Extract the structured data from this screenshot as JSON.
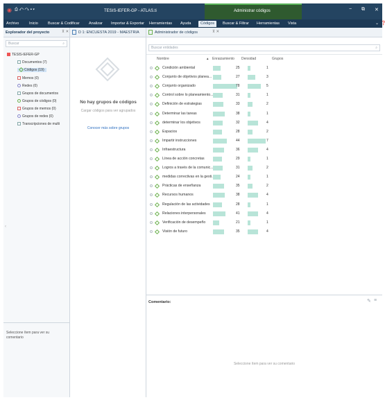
{
  "window": {
    "title": "TESIS-IEFER-GP - ATLAS.ti",
    "context_tab": "Administrar códigos",
    "controls": [
      "−",
      "⧉",
      "✕"
    ]
  },
  "ribbon": {
    "tabs": [
      {
        "label": "Archivo",
        "active": false
      },
      {
        "label": "Inicio",
        "active": false
      },
      {
        "label": "Buscar & Codificar",
        "active": false
      },
      {
        "label": "Analizar",
        "active": false
      },
      {
        "label": "Importar & Exportar",
        "active": false
      },
      {
        "label": "Herramientas",
        "active": false
      },
      {
        "label": "Ayuda",
        "active": false
      },
      {
        "label": "Códigos",
        "active": true
      },
      {
        "label": "Buscar & Filtrar",
        "active": false
      },
      {
        "label": "Herramientas",
        "active": false
      },
      {
        "label": "Vista",
        "active": false
      }
    ]
  },
  "explorer": {
    "title": "Explorador del proyecto",
    "search_placeholder": "Buscar",
    "items": [
      {
        "label": "TESIS-IEFER-GP",
        "icon": "project-icon",
        "indent": 0
      },
      {
        "label": "Documentos (7)",
        "icon": "document-icon",
        "indent": 1
      },
      {
        "label": "Códigos (19)",
        "icon": "code-icon",
        "indent": 1,
        "selected": true
      },
      {
        "label": "Memos (0)",
        "icon": "memo-icon",
        "indent": 1
      },
      {
        "label": "Redes (0)",
        "icon": "network-icon",
        "indent": 1
      },
      {
        "label": "Grupos de documentos",
        "icon": "doc-group-icon",
        "indent": 1
      },
      {
        "label": "Grupos de códigos (0)",
        "icon": "code-group-icon",
        "indent": 1
      },
      {
        "label": "Grupos de memos (0)",
        "icon": "memo-group-icon",
        "indent": 1
      },
      {
        "label": "Grupos de redes (0)",
        "icon": "network-group-icon",
        "indent": 1
      },
      {
        "label": "Transcripciones de multi",
        "icon": "transcript-icon",
        "indent": 1
      }
    ],
    "comment_hint": "Seleccione ítem para ver su comentario"
  },
  "groups_panel": {
    "tab": "D 1: ENCUESTA 2019 - MAESTRIA",
    "empty_title": "No hay grupos de códigos",
    "empty_subtitle": "Cargar códigos para ver agrupados",
    "learn_more": "Conocer más sobre grupos"
  },
  "codes_manager": {
    "tab": "Administrador de códigos",
    "search_placeholder": "Buscar entidades",
    "columns": {
      "name": "Nombre",
      "grounded": "Enraizamiento",
      "density": "Densidad",
      "groups": "Grupos"
    },
    "sort_indicator": "▲",
    "rows": [
      {
        "name": "Condición ambiental",
        "grounded": 25,
        "density": 1
      },
      {
        "name": "Conjunto de objetivos planea...",
        "grounded": 27,
        "density": 3
      },
      {
        "name": "Conjunto organizado",
        "grounded": 78,
        "density": 5
      },
      {
        "name": "Control sobre lo planeamiento...",
        "grounded": 31,
        "density": 1
      },
      {
        "name": "Definición de estrategias",
        "grounded": 33,
        "density": 2
      },
      {
        "name": "Determinar las tareas",
        "grounded": 38,
        "density": 1
      },
      {
        "name": "determinar los objetivos",
        "grounded": 32,
        "density": 4
      },
      {
        "name": "Espacios",
        "grounded": 28,
        "density": 2
      },
      {
        "name": "Impartir instrucciones",
        "grounded": 44,
        "density": 7
      },
      {
        "name": "Infraestructura",
        "grounded": 36,
        "density": 4
      },
      {
        "name": "Línea de acción concretas",
        "grounded": 29,
        "density": 1
      },
      {
        "name": "Logros a través de la comunic...",
        "grounded": 31,
        "density": 2
      },
      {
        "name": "medidas correctivas en la gesti...",
        "grounded": 24,
        "density": 1
      },
      {
        "name": "Prácticas de enseñanza",
        "grounded": 35,
        "density": 2
      },
      {
        "name": "Recursos humanos",
        "grounded": 38,
        "density": 4
      },
      {
        "name": "Regulación de las actividades",
        "grounded": 28,
        "density": 1
      },
      {
        "name": "Relaciones interpersonales",
        "grounded": 41,
        "density": 4
      },
      {
        "name": "Verificación de desempeño",
        "grounded": 21,
        "density": 1
      },
      {
        "name": "Visión de futuro",
        "grounded": 35,
        "density": 4
      }
    ],
    "comment_label": "Comentario:",
    "comment_hint": "Seleccione ítem para ver su comentario"
  },
  "colors": {
    "titlebar": "#244461",
    "ribbon": "#1d3a56",
    "context_band": "#2f5a2f",
    "bar": "#b8e4d8",
    "code_green": "#6ab04c"
  }
}
